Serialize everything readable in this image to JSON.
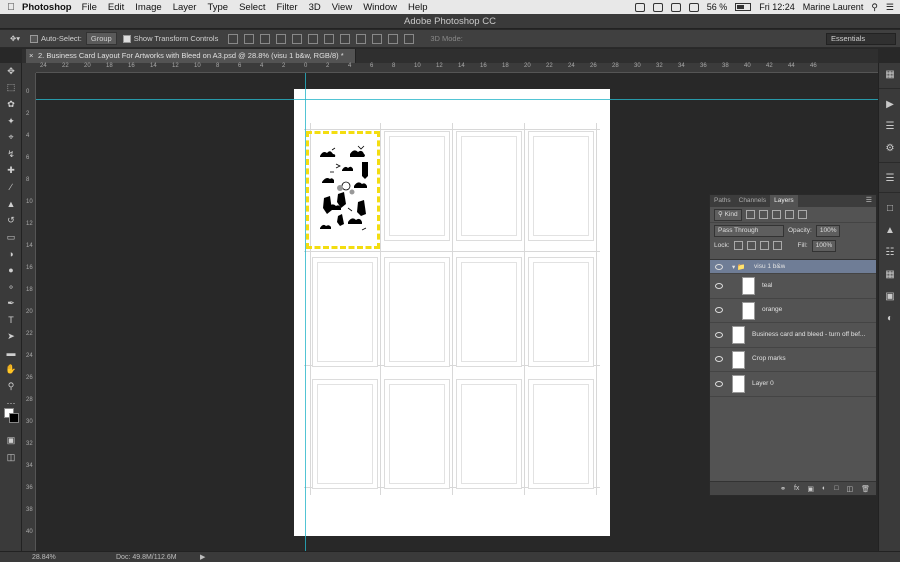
{
  "menubar": {
    "app_name": "Photoshop",
    "items": [
      "File",
      "Edit",
      "Image",
      "Layer",
      "Type",
      "Select",
      "Filter",
      "3D",
      "View",
      "Window",
      "Help"
    ],
    "battery": "56 %",
    "clock": "Fri 12:24",
    "user": "Marine Laurent"
  },
  "app_title": "Adobe Photoshop CC",
  "options": {
    "auto_select_label": "Auto-Select:",
    "auto_select_value": "Group",
    "transform_label": "Show Transform Controls",
    "mode_3d": "3D Mode:",
    "workspace": "Essentials"
  },
  "document_tab": "2. Business Card Layout For Artworks with Bleed on A3.psd @ 28.8% (visu 1 b&w, RGB/8) *",
  "ruler": {
    "h_ticks": [
      "24",
      "22",
      "20",
      "18",
      "16",
      "14",
      "12",
      "10",
      "8",
      "6",
      "4",
      "2",
      "0",
      "2",
      "4",
      "6",
      "8",
      "10",
      "12",
      "14",
      "16",
      "18",
      "20",
      "22",
      "24",
      "26",
      "28",
      "30",
      "32",
      "34",
      "36",
      "38",
      "40",
      "42",
      "44",
      "46"
    ],
    "v_ticks": [
      "0",
      "2",
      "4",
      "6",
      "8",
      "10",
      "12",
      "14",
      "16",
      "18",
      "20",
      "22",
      "24",
      "26",
      "28",
      "30",
      "32",
      "34",
      "36",
      "38",
      "40"
    ]
  },
  "status": {
    "zoom": "28.84%",
    "doc_size": "Doc: 49.8M/112.6M",
    "arrow": "▶"
  },
  "layers_panel": {
    "tabs": [
      "Paths",
      "Channels",
      "Layers"
    ],
    "active_tab": "Layers",
    "filter_kind": "Kind",
    "blend_mode": "Pass Through",
    "opacity_label": "Opacity:",
    "opacity_value": "100%",
    "lock_label": "Lock:",
    "fill_label": "Fill:",
    "fill_value": "100%",
    "layers": [
      {
        "name": "visu 1 b&w",
        "type": "group"
      },
      {
        "name": "teal",
        "type": "layer"
      },
      {
        "name": "orange",
        "type": "layer"
      },
      {
        "name": "Business card and bleed - turn off bef...",
        "type": "smart"
      },
      {
        "name": "Crop marks",
        "type": "smart"
      },
      {
        "name": "Layer 0",
        "type": "layer"
      }
    ]
  },
  "colors": {
    "selection": "#f3dd10",
    "guide": "#27b5c9",
    "group_highlight": "#6f7d96"
  }
}
